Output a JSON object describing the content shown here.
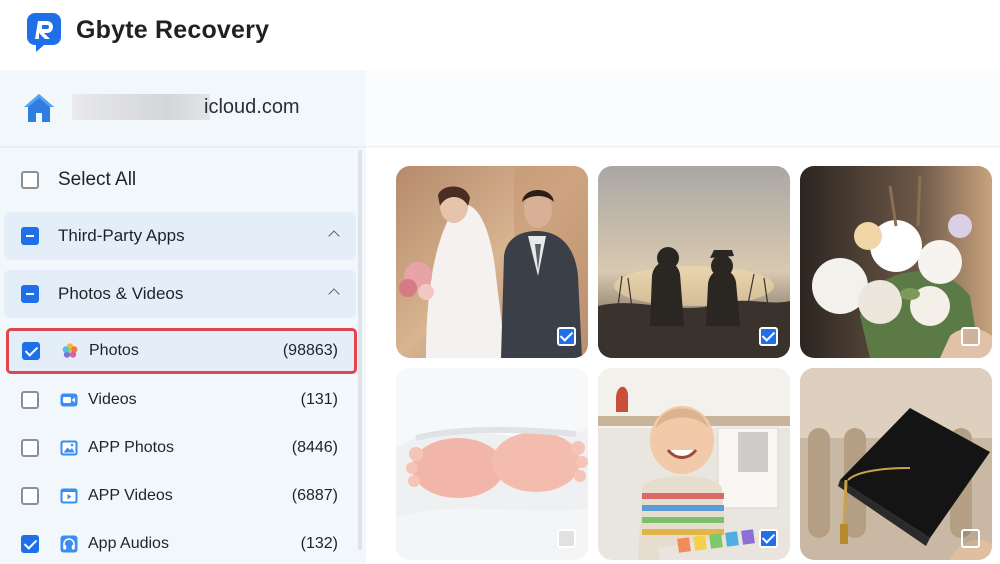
{
  "app": {
    "title": "Gbyte Recovery",
    "accent": "#1e6fe8",
    "highlight": "#e0464d"
  },
  "account": {
    "email_visible": "icloud.com"
  },
  "sidebar": {
    "select_all": {
      "label": "Select All",
      "checked": false
    },
    "groups": [
      {
        "label": "Third-Party Apps",
        "state": "partial",
        "expanded": true
      },
      {
        "label": "Photos & Videos",
        "state": "partial",
        "expanded": true
      }
    ],
    "items": [
      {
        "label": "Photos",
        "count": "(98863)",
        "checked": true,
        "icon": "photos-icon",
        "active": true
      },
      {
        "label": "Videos",
        "count": "(131)",
        "checked": false,
        "icon": "video-camera-icon"
      },
      {
        "label": "APP Photos",
        "count": "(8446)",
        "checked": false,
        "icon": "app-photos-icon"
      },
      {
        "label": "APP Videos",
        "count": "(6887)",
        "checked": false,
        "icon": "app-videos-icon"
      },
      {
        "label": "App Audios",
        "count": "(132)",
        "checked": true,
        "icon": "headphones-icon"
      }
    ]
  },
  "gallery": {
    "tiles": [
      {
        "subject": "wedding couple photo",
        "checked": true
      },
      {
        "subject": "silhouette couple at sunset",
        "checked": true
      },
      {
        "subject": "white flower bouquet",
        "checked": false
      },
      {
        "subject": "baby feet in blanket",
        "checked": false
      },
      {
        "subject": "smiling baby with toy xylophone",
        "checked": true
      },
      {
        "subject": "graduation cap",
        "checked": false
      }
    ]
  }
}
